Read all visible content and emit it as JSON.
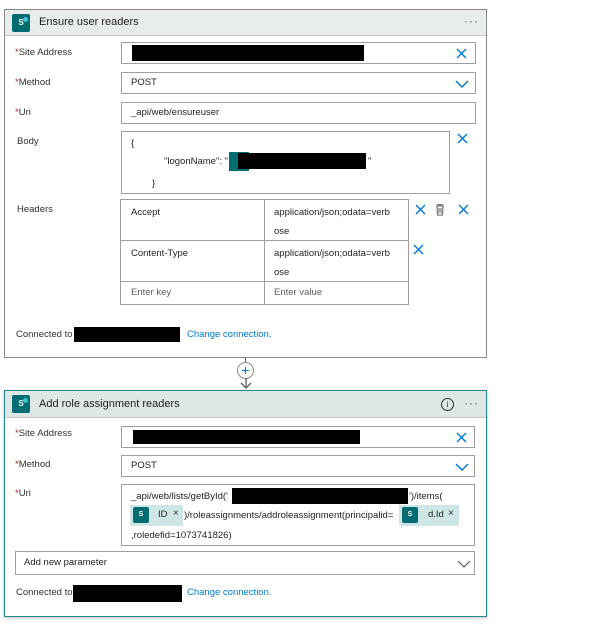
{
  "card1": {
    "title": "Ensure user readers",
    "more": "···",
    "site_address_label": "Site Address",
    "method_label": "Method",
    "method_value": "POST",
    "uri_label": "Uri",
    "uri_value": "_api/web/ensureuser",
    "body_label": "Body",
    "body_open": "{",
    "body_key": "\"logonName\": \"",
    "body_close_quote": "\"",
    "body_close": "}",
    "headers_label": "Headers",
    "headers": [
      {
        "key": "Accept",
        "value_line1": "application/json;odata=verb",
        "value_line2": "ose"
      },
      {
        "key": "Content-Type",
        "value_line1": "application/json;odata=verb",
        "value_line2": "ose"
      }
    ],
    "key_placeholder": "Enter key",
    "value_placeholder": "Enter value",
    "connected_to": "Connected to",
    "change_connection": "Change connection."
  },
  "connector": {
    "plus": "+"
  },
  "card2": {
    "title": "Add role assignment readers",
    "info": "i",
    "more": "···",
    "site_address_label": "Site Address",
    "method_label": "Method",
    "method_value": "POST",
    "uri_label": "Uri",
    "uri_line1_a": "_api/web/lists/getById('",
    "uri_line1_b": "')/items(",
    "token_id": "ID",
    "uri_line2": ")/roleassignments/addroleassignment(principalid=",
    "token_did": "d.Id",
    "uri_line3": ",roledefid=1073741826)",
    "add_param": "Add new parameter",
    "connected_to": "Connected to",
    "change_connection": "Change connection."
  },
  "required_mark": "*",
  "token_close": "×",
  "icon_names": [
    "sharepoint-icon",
    "close-icon",
    "chevron-down-icon",
    "delete-icon",
    "info-icon",
    "add-icon",
    "arrow-down-icon"
  ],
  "colors": {
    "accent": "#0078d4",
    "sharepoint": "#036c70",
    "selected_border": "#1f8a8a",
    "required": "#a4262c"
  }
}
